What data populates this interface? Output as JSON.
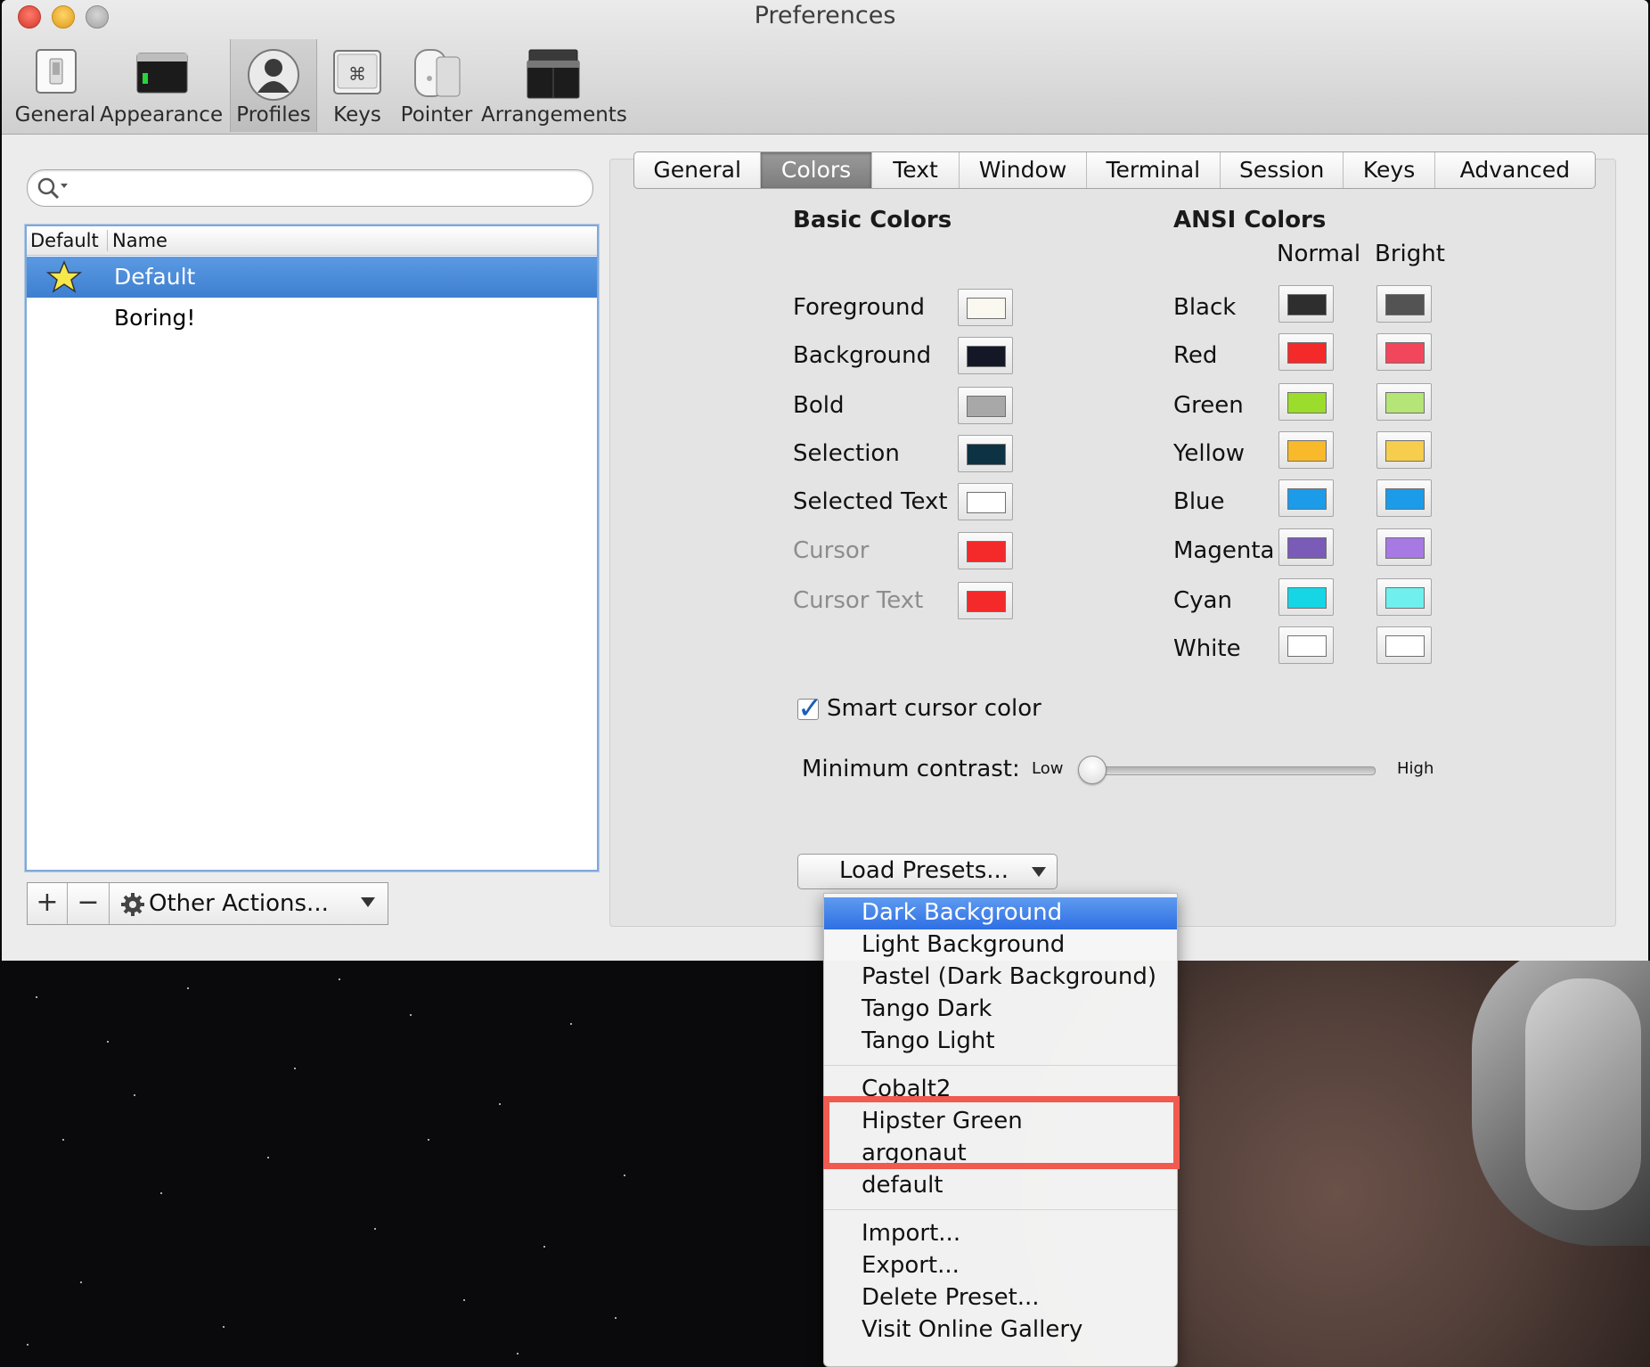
{
  "window": {
    "title": "Preferences"
  },
  "toolbar": {
    "items": [
      {
        "label": "General",
        "icon": "switch-icon"
      },
      {
        "label": "Appearance",
        "icon": "terminal-window-icon"
      },
      {
        "label": "Profiles",
        "icon": "person-silhouette-icon"
      },
      {
        "label": "Keys",
        "icon": "command-key-icon"
      },
      {
        "label": "Pointer",
        "icon": "mouse-icon"
      },
      {
        "label": "Arrangements",
        "icon": "windows-stack-icon"
      }
    ],
    "active": "Profiles"
  },
  "profiles": {
    "search_value": "",
    "columns": [
      "Default",
      "Name"
    ],
    "rows": [
      {
        "name": "Default",
        "is_default": true,
        "selected": true
      },
      {
        "name": "Boring!",
        "is_default": false,
        "selected": false
      }
    ],
    "add_label": "+",
    "remove_label": "−",
    "other_actions_label": "Other Actions..."
  },
  "tabs": {
    "items": [
      "General",
      "Colors",
      "Text",
      "Window",
      "Terminal",
      "Session",
      "Keys",
      "Advanced"
    ],
    "active": "Colors"
  },
  "basic_colors": {
    "heading": "Basic Colors",
    "items": [
      {
        "label": "Foreground",
        "color": "#fbf8f0",
        "enabled": true
      },
      {
        "label": "Background",
        "color": "#141826",
        "enabled": true
      },
      {
        "label": "Bold",
        "color": "#a8a8a8",
        "enabled": true
      },
      {
        "label": "Selection",
        "color": "#0d3244",
        "enabled": true
      },
      {
        "label": "Selected Text",
        "color": "#ffffff",
        "enabled": true
      },
      {
        "label": "Cursor",
        "color": "#f42a2a",
        "enabled": false
      },
      {
        "label": "Cursor Text",
        "color": "#f42a2a",
        "enabled": false
      }
    ]
  },
  "ansi_colors": {
    "heading": "ANSI Colors",
    "normal_label": "Normal",
    "bright_label": "Bright",
    "items": [
      {
        "label": "Black",
        "normal": "#2e2e2e",
        "bright": "#535353"
      },
      {
        "label": "Red",
        "normal": "#f42a2a",
        "bright": "#f2465c"
      },
      {
        "label": "Green",
        "normal": "#9bdc2c",
        "bright": "#b5e477"
      },
      {
        "label": "Yellow",
        "normal": "#f8b92a",
        "bright": "#f7cd4e"
      },
      {
        "label": "Blue",
        "normal": "#1c9be8",
        "bright": "#1c9be8"
      },
      {
        "label": "Magenta",
        "normal": "#7a5bb7",
        "bright": "#a679e3"
      },
      {
        "label": "Cyan",
        "normal": "#16d6e6",
        "bright": "#6ff0ee"
      },
      {
        "label": "White",
        "normal": "#ffffff",
        "bright": "#ffffff"
      }
    ]
  },
  "smart_cursor": {
    "label": "Smart cursor color",
    "checked": true
  },
  "contrast": {
    "label": "Minimum contrast:",
    "low": "Low",
    "high": "High",
    "value": 0
  },
  "presets": {
    "button_label": "Load Presets...",
    "menu": [
      {
        "label": "Dark Background",
        "highlighted": true
      },
      {
        "label": "Light Background"
      },
      {
        "label": "Pastel (Dark Background)"
      },
      {
        "label": "Tango Dark"
      },
      {
        "label": "Tango Light"
      },
      {
        "separator": true
      },
      {
        "label": "Cobalt2"
      },
      {
        "label": "Hipster Green"
      },
      {
        "label": "argonaut"
      },
      {
        "label": "default"
      },
      {
        "separator": true
      },
      {
        "label": "Import..."
      },
      {
        "label": "Export..."
      },
      {
        "label": "Delete Preset..."
      },
      {
        "label": "Visit Online Gallery"
      }
    ]
  },
  "colors": {
    "accent": "#3d7fd0",
    "annotation": "#f05a4f"
  }
}
